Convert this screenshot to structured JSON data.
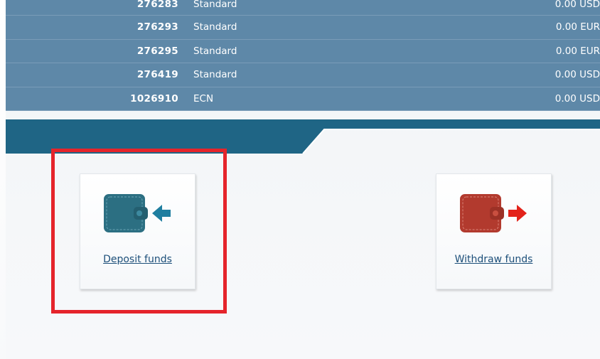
{
  "accounts": [
    {
      "number": "276283",
      "type": "Standard",
      "balance": "0.00 USD"
    },
    {
      "number": "276293",
      "type": "Standard",
      "balance": "0.00 EUR"
    },
    {
      "number": "276295",
      "type": "Standard",
      "balance": "0.00 EUR"
    },
    {
      "number": "276419",
      "type": "Standard",
      "balance": "0.00 USD"
    },
    {
      "number": "1026910",
      "type": "ECN",
      "balance": "0.00 USD"
    }
  ],
  "actions": {
    "deposit_label": "Deposit funds",
    "withdraw_label": "Withdraw funds"
  },
  "colors": {
    "row_bg": "#5e88a8",
    "band": "#1f6585",
    "deposit_icon": "#2c6f82",
    "withdraw_icon": "#b23a2e",
    "highlight": "#e5242b"
  },
  "icons": {
    "deposit": "wallet-arrow-in-icon",
    "withdraw": "wallet-arrow-out-icon"
  }
}
